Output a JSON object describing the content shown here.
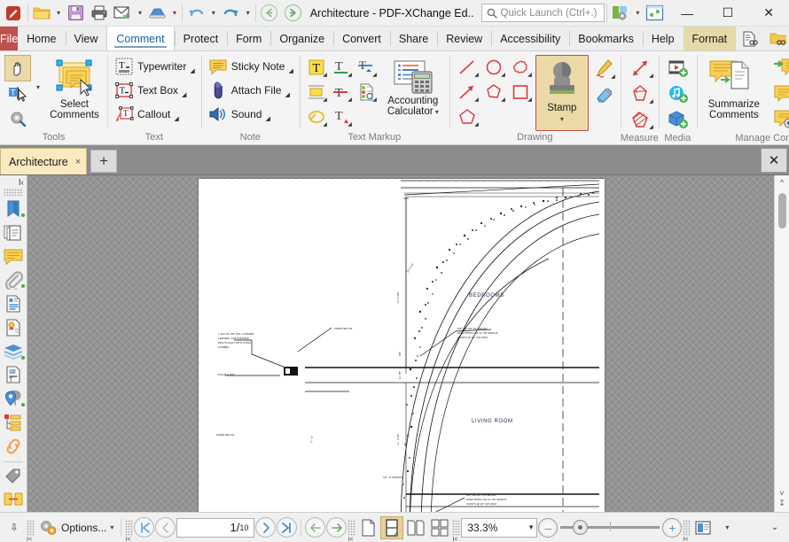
{
  "titlebar": {
    "doc_title": "Architecture - PDF-XChange Ed..",
    "quick_launch_placeholder": "Quick Launch (Ctrl+.)",
    "buttons": [
      {
        "name": "app-logo-icon",
        "label": ""
      },
      {
        "name": "open-file-icon",
        "label": ""
      },
      {
        "name": "save-file-icon",
        "label": ""
      },
      {
        "name": "print-icon",
        "label": ""
      },
      {
        "name": "email-icon",
        "label": ""
      },
      {
        "name": "scan-icon",
        "label": ""
      },
      {
        "name": "undo-icon",
        "label": ""
      },
      {
        "name": "redo-icon",
        "label": ""
      },
      {
        "name": "back-icon",
        "label": ""
      },
      {
        "name": "forward-icon",
        "label": ""
      }
    ],
    "window_controls": {
      "minimize": "—",
      "maximize": "☐",
      "close": "✕"
    }
  },
  "menubar": {
    "file_label": "File",
    "tabs": [
      {
        "label": "Home",
        "state": "normal"
      },
      {
        "label": "View",
        "state": "normal"
      },
      {
        "label": "Comment",
        "state": "active"
      },
      {
        "label": "Protect",
        "state": "normal"
      },
      {
        "label": "Form",
        "state": "normal"
      },
      {
        "label": "Organize",
        "state": "normal"
      },
      {
        "label": "Convert",
        "state": "normal"
      },
      {
        "label": "Share",
        "state": "normal"
      },
      {
        "label": "Review",
        "state": "normal"
      },
      {
        "label": "Accessibility",
        "state": "normal"
      },
      {
        "label": "Bookmarks",
        "state": "normal"
      },
      {
        "label": "Help",
        "state": "normal"
      },
      {
        "label": "Format",
        "state": "highlighted"
      }
    ],
    "right_icons": [
      "document-search-icon",
      "folder-search-icon",
      "collapse-ribbon-icon"
    ]
  },
  "ribbon": {
    "groups": [
      {
        "name": "tools",
        "label": "Tools",
        "items": [
          {
            "name": "hand-tool",
            "label": ""
          },
          {
            "name": "select-text-tool",
            "label": ""
          },
          {
            "name": "tool-settings",
            "label": ""
          },
          {
            "name": "select-comments",
            "label": "Select\nComments"
          }
        ],
        "select_comments_line1": "Select",
        "select_comments_line2": "Comments"
      },
      {
        "name": "text",
        "label": "Text",
        "items": [
          {
            "name": "typewriter-tool",
            "label": "Typewriter"
          },
          {
            "name": "text-box-tool",
            "label": "Text Box"
          },
          {
            "name": "callout-tool",
            "label": "Callout"
          }
        ]
      },
      {
        "name": "note",
        "label": "Note",
        "items": [
          {
            "name": "sticky-note-tool",
            "label": "Sticky Note"
          },
          {
            "name": "attach-file-tool",
            "label": "Attach File"
          },
          {
            "name": "sound-tool",
            "label": "Sound"
          }
        ]
      },
      {
        "name": "text-markup",
        "label": "Text Markup",
        "items": [
          {
            "name": "highlight-text-tool",
            "label": ""
          },
          {
            "name": "underline-text-tool",
            "label": ""
          },
          {
            "name": "squiggly-underline-tool",
            "label": ""
          },
          {
            "name": "highlight-area-tool",
            "label": ""
          },
          {
            "name": "strikeout-text-tool",
            "label": ""
          },
          {
            "name": "review-comments-tool",
            "label": ""
          },
          {
            "name": "circle-text-tool",
            "label": ""
          },
          {
            "name": "insert-caret-tool",
            "label": ""
          }
        ],
        "accounting_line1": "Accounting",
        "accounting_line2": "Calculator"
      },
      {
        "name": "drawing",
        "label": "Drawing",
        "items": [
          {
            "name": "line-tool",
            "label": ""
          },
          {
            "name": "ellipse-tool",
            "label": ""
          },
          {
            "name": "cloud-tool",
            "label": ""
          },
          {
            "name": "arrow-tool",
            "label": ""
          },
          {
            "name": "polyline-tool",
            "label": ""
          },
          {
            "name": "rectangle-tool",
            "label": ""
          },
          {
            "name": "polygon-tool",
            "label": ""
          },
          {
            "name": "pencil-tool",
            "label": ""
          },
          {
            "name": "eraser-tool",
            "label": ""
          }
        ],
        "stamp_label": "Stamp"
      },
      {
        "name": "measure",
        "label": "Measure",
        "items": [
          {
            "name": "distance-measure-tool",
            "label": ""
          },
          {
            "name": "perimeter-measure-tool",
            "label": ""
          },
          {
            "name": "area-measure-tool",
            "label": ""
          }
        ]
      },
      {
        "name": "media",
        "label": "Media",
        "items": [
          {
            "name": "add-video-tool",
            "label": ""
          },
          {
            "name": "add-audio-tool",
            "label": ""
          },
          {
            "name": "add-3d-tool",
            "label": ""
          }
        ]
      },
      {
        "name": "manage-comments",
        "label": "Manage Comments",
        "summarize_line1": "Summarize",
        "summarize_line2": "Comments",
        "items": [
          {
            "name": "import-comments",
            "label": ""
          },
          {
            "name": "flatten-comments",
            "label": ""
          },
          {
            "name": "export-comments",
            "label": ""
          },
          {
            "name": "comments-list",
            "label": ""
          },
          {
            "name": "show-hide-comments",
            "label": ""
          },
          {
            "name": "comment-styles",
            "label": ""
          }
        ]
      }
    ]
  },
  "tabstrip": {
    "tabs": [
      {
        "label": "Architecture",
        "close": "×"
      }
    ],
    "new_tab": "+",
    "close_doc": "✕"
  },
  "navpane": {
    "collapse": "I‹",
    "items": [
      {
        "name": "bookmarks-panel-icon",
        "badge": true
      },
      {
        "name": "thumbnails-panel-icon",
        "badge": false
      },
      {
        "name": "comments-panel-icon",
        "badge": false
      },
      {
        "name": "attachments-panel-icon",
        "badge": true
      },
      {
        "name": "content-panel-icon",
        "badge": false
      },
      {
        "name": "signatures-panel-icon",
        "badge": false
      },
      {
        "name": "layers-panel-icon",
        "badge": true
      },
      {
        "name": "optimize-panel-icon",
        "badge": false
      },
      {
        "name": "destinations-panel-icon",
        "badge": true
      },
      {
        "name": "fields-panel-icon",
        "badge": false
      },
      {
        "name": "links-panel-icon",
        "badge": false
      },
      {
        "name": "tags-panel-icon",
        "badge": false
      },
      {
        "name": "stamps-panel-icon",
        "badge": false
      }
    ]
  },
  "document": {
    "labels": {
      "bedrooms": "BEDROOMS",
      "living_room": "LIVING ROOM",
      "radius": "18' - 0\"  RADIUS",
      "form_set_3": "FORM SET #3",
      "form_set_2": "FORM SET #2",
      "pour_joint_1": "POUR JOINT",
      "pour_joint_2": "POUR JOINT",
      "ledger_note": "1 3/4\"x11 7/8\" SCL 'CURVED' LEDGER, C/W ANCHOR BOLTS CAST INTO CONC CORBEL",
      "plywood_note_1": "5/8\" OR 3/4\" PLYWOOD SHEATHING ON 11 7/8\" MANUF JOISTS @ 16\" O/C MAX",
      "plywood_note_2": "5/8\" OR 3/4\" PLYWOOD SHEATHING ON 11 7/8\" MANUF JOISTS @ 16\" O/C MAX",
      "dim_height_1": "11'-2 5/8\"",
      "dim_height_2": "9' - 0 3/4\"",
      "dim_small_1": "5/8\"",
      "dim_small_2": "11 7/8\"",
      "dim_arc_1": "12' 2 1/4\"",
      "dim_arc_2": "2' - 0\""
    }
  },
  "statusbar": {
    "options_label": "Options...",
    "page_current": "1",
    "page_sep": "/",
    "page_total": "10",
    "zoom_value": "33.3%",
    "zoom_out": "–",
    "zoom_in": "+",
    "nav_buttons": [
      {
        "name": "first-page-button",
        "glyph": "|‹"
      },
      {
        "name": "previous-page-button",
        "glyph": "‹"
      },
      {
        "name": "next-page-button",
        "glyph": "›"
      },
      {
        "name": "last-page-button",
        "glyph": "›|"
      },
      {
        "name": "previous-view-button",
        "glyph": "←"
      },
      {
        "name": "next-view-button",
        "glyph": "→"
      }
    ],
    "layout_buttons": [
      {
        "name": "single-page-layout-button",
        "active": false
      },
      {
        "name": "continuous-layout-button",
        "active": true
      },
      {
        "name": "two-page-layout-button",
        "active": false
      },
      {
        "name": "two-page-continuous-layout-button",
        "active": false
      }
    ]
  },
  "colors": {
    "file_tab": "#c0504d",
    "active_tab_text": "#1a5fa0",
    "format_tab_bg": "#e5d9a8",
    "stamp_highlight_bg": "#ecd9a8",
    "stamp_border": "#c0504d",
    "doc_tab_bg": "#fbe9c0",
    "accent_blue": "#4a90c4",
    "badge_green": "#57a83a"
  }
}
